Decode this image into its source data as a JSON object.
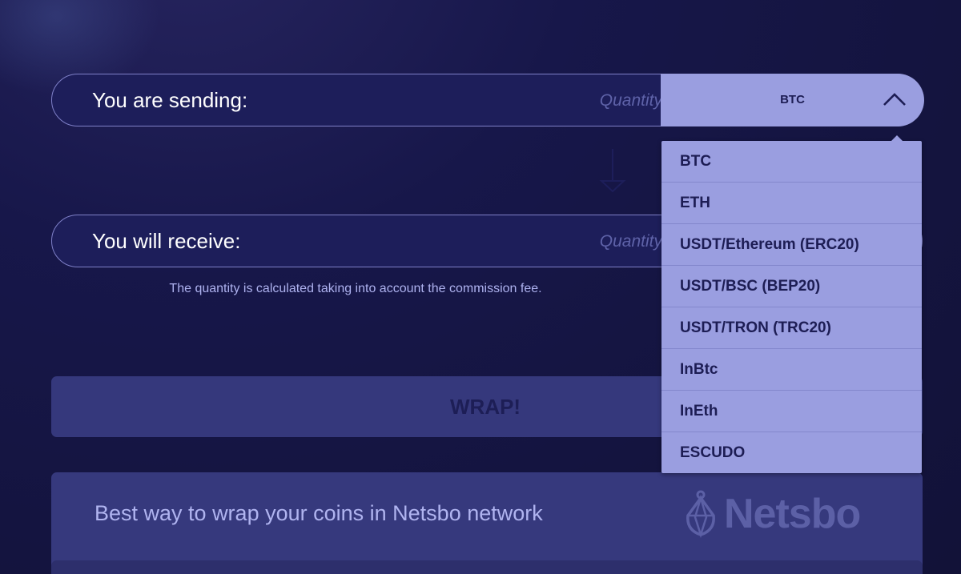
{
  "sending": {
    "label": "You are sending:",
    "quantity_placeholder": "Quantity",
    "selected_currency": "BTC"
  },
  "receiving": {
    "label": "You will receive:",
    "quantity_placeholder": "Quantity"
  },
  "note": "The quantity is calculated taking into account the commission fee.",
  "wrap_button": "WRAP!",
  "dropdown": {
    "options": [
      "BTC",
      "ETH",
      "USDT/Ethereum (ERC20)",
      "USDT/BSC (BEP20)",
      "USDT/TRON (TRC20)",
      "InBtc",
      "InEth",
      "ESCUDO"
    ]
  },
  "banner": {
    "text": "Best way to wrap your coins in Netsbo network",
    "logo_text": "Netsbo"
  },
  "icons": {
    "chevron": "chevron-up-icon",
    "arrow": "arrow-down-icon",
    "logo": "netsbo-logo-icon"
  },
  "colors": {
    "background": "#14143f",
    "input_bg": "#1d1e5a",
    "select_bg": "#9a9ee0",
    "button_bg": "#35387c",
    "text_light": "#ffffff",
    "text_dark": "#1d1d54"
  }
}
